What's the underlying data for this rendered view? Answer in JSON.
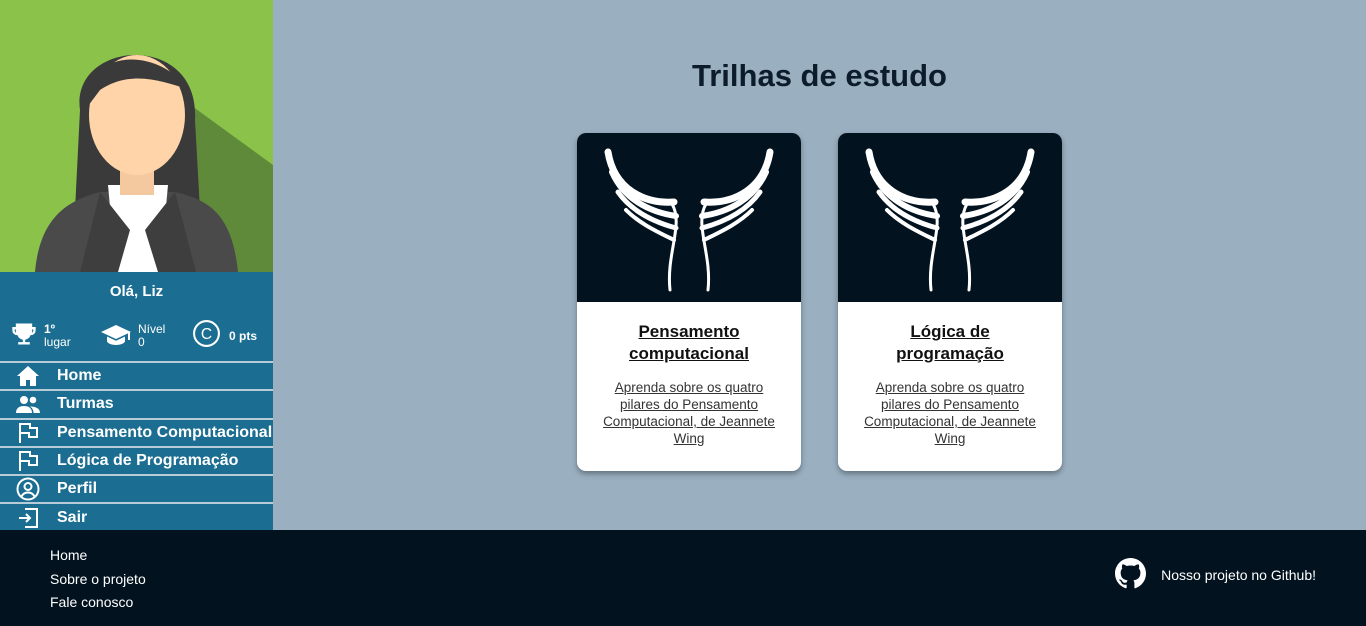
{
  "sidebar": {
    "greeting": "Olá, Liz",
    "stats": {
      "rank_value": "1º",
      "rank_label": "lugar",
      "level_label": "Nível",
      "level_value": "0",
      "points": "0 pts"
    },
    "nav": [
      {
        "label": "Home",
        "icon": "home-icon"
      },
      {
        "label": "Turmas",
        "icon": "users-icon"
      },
      {
        "label": "Pensamento Computacional",
        "icon": "flag-icon"
      },
      {
        "label": "Lógica de Programação",
        "icon": "flag-icon"
      },
      {
        "label": "Perfil",
        "icon": "user-circle-icon"
      },
      {
        "label": "Sair",
        "icon": "logout-icon"
      }
    ]
  },
  "main": {
    "title": "Trilhas de estudo",
    "cards": [
      {
        "title": "Pensamento computacional",
        "description": "Aprenda sobre os quatro pilares do Pensamento Computacional, de Jeannete Wing"
      },
      {
        "title": "Lógica de programação",
        "description": "Aprenda sobre os quatro pilares do Pensamento Computacional, de Jeannete Wing"
      }
    ]
  },
  "footer": {
    "links": [
      "Home",
      "Sobre o projeto",
      "Fale conosco"
    ],
    "github_label": "Nosso projeto no Github!"
  },
  "colors": {
    "sidebar": "#1b6e92",
    "main_bg": "#9ab0c1",
    "footer_bg": "#02131f",
    "card_image_bg": "#02131f",
    "avatar_bg": "#8bc34a"
  }
}
